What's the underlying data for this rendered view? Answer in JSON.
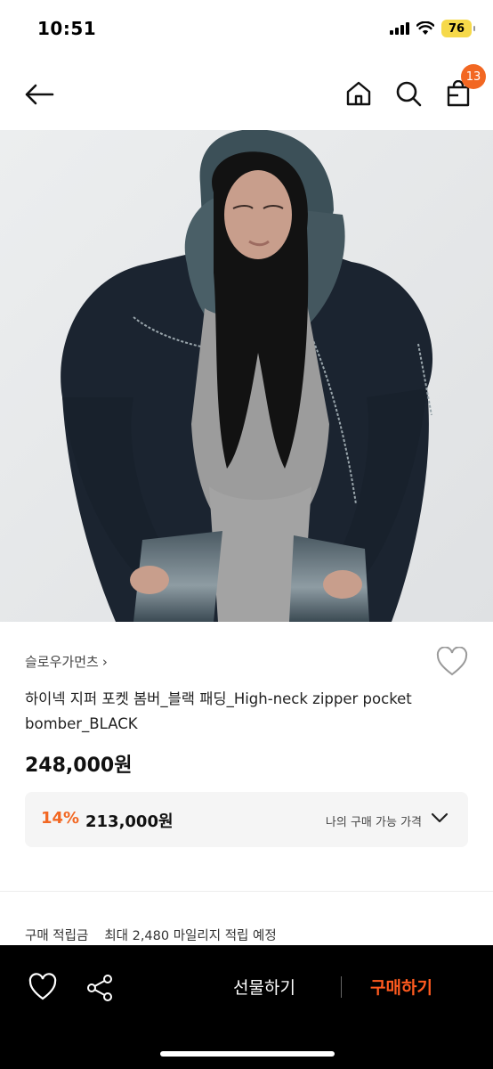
{
  "status_bar": {
    "time": "10:51",
    "battery": "76"
  },
  "nav": {
    "cart_count": "13"
  },
  "product": {
    "brand": "슬로우가먼츠",
    "brand_chevron": "›",
    "title": "하이넥 지퍼 포켓 봄버_블랙 패딩_High-neck zipper pocket bomber_BLACK",
    "original_price": "248,000원",
    "discount_rate": "14%",
    "discount_price": "213,000원",
    "price_box_label": "나의 구매 가능 가격",
    "points_label": "구매 적립금",
    "points_value": "최대 2,480 마일리지 적립 예정"
  },
  "bottom_bar": {
    "gift_label": "선물하기",
    "buy_label": "구매하기"
  },
  "colors": {
    "accent": "#f26722",
    "buy": "#ff5a1f",
    "bar": "#000000"
  },
  "icons": [
    "back-arrow-icon",
    "home-icon",
    "search-icon",
    "cart-icon",
    "heart-icon",
    "share-icon",
    "chevron-down-icon"
  ]
}
